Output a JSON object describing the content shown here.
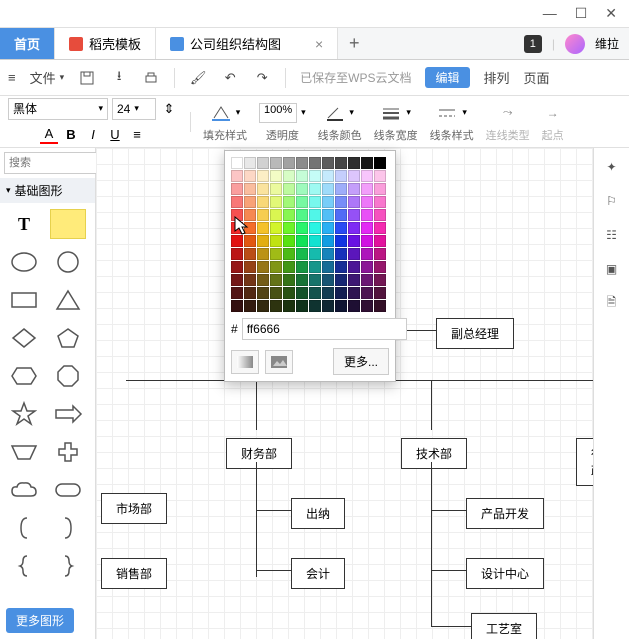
{
  "window": {
    "min": "—",
    "max": "☐",
    "close": "✕"
  },
  "tabs": {
    "home": "首页",
    "template": "稻壳模板",
    "doc": "公司组织结构图",
    "badge": "1",
    "user": "维拉"
  },
  "toolbar1": {
    "file": "文件",
    "save_status": "已保存至WPS云文档",
    "edit": "编辑",
    "arrange": "排列",
    "page": "页面"
  },
  "toolbar2": {
    "font": "黑体",
    "size": "24",
    "zoom": "100%",
    "fill_style": "填充样式",
    "opacity": "透明度",
    "line_color": "线条颜色",
    "line_width": "线条宽度",
    "line_style": "线条样式",
    "connector_type": "连线类型",
    "endpoint": "起点"
  },
  "sidebar": {
    "search_placeholder": "搜索",
    "basic_shapes": "基础图形",
    "more": "更多图形"
  },
  "org": {
    "vp": "副总经理",
    "finance": "财务部",
    "tech": "技术部",
    "admin": "行政",
    "market": "市场部",
    "sales": "销售部",
    "cashier": "出纳",
    "accounting": "会计",
    "product": "产品开发",
    "design": "设计中心",
    "craft": "工艺室"
  },
  "popup": {
    "hex_prefix": "#",
    "hex_value": "ff6666",
    "more": "更多..."
  },
  "chart_data": {
    "type": "org_chart",
    "title": "公司组织结构图",
    "selected_fill_color": "#ff6666",
    "nodes": [
      {
        "id": "vp",
        "label": "副总经理",
        "children": [
          "finance",
          "tech",
          "admin"
        ]
      },
      {
        "id": "finance",
        "label": "财务部",
        "children": [
          "cashier",
          "accounting"
        ]
      },
      {
        "id": "tech",
        "label": "技术部",
        "children": [
          "product",
          "design",
          "craft"
        ]
      },
      {
        "id": "admin",
        "label": "行政",
        "children": []
      },
      {
        "id": "market",
        "label": "市场部",
        "children": []
      },
      {
        "id": "sales",
        "label": "销售部",
        "children": []
      },
      {
        "id": "cashier",
        "label": "出纳"
      },
      {
        "id": "accounting",
        "label": "会计"
      },
      {
        "id": "product",
        "label": "产品开发"
      },
      {
        "id": "design",
        "label": "设计中心"
      },
      {
        "id": "craft",
        "label": "工艺室"
      }
    ]
  }
}
